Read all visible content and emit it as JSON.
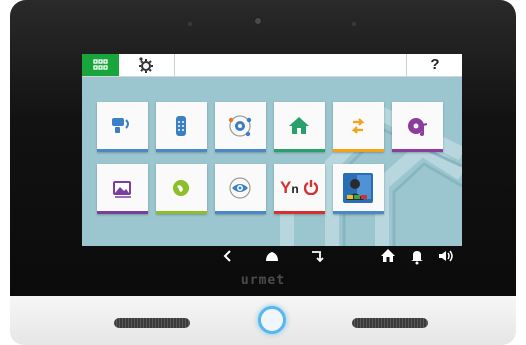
{
  "brand": {
    "logo_text": "urmet"
  },
  "topbar": {
    "home_icon": "grid-icon",
    "settings_icon": "gear-icon",
    "help_label": "?"
  },
  "tiles": [
    {
      "name": "intercom",
      "icon": "intercom-handset-icon",
      "bar_color": "#4a88c8"
    },
    {
      "name": "remote",
      "icon": "remote-control-icon",
      "bar_color": "#4a88c8"
    },
    {
      "name": "cctv-network",
      "icon": "cctv-network-icon",
      "bar_color": "#4a88c8"
    },
    {
      "name": "home-automation",
      "icon": "house-icon",
      "bar_color": "#27a06a"
    },
    {
      "name": "transfer",
      "icon": "swap-arrows-icon",
      "bar_color": "#f2a317"
    },
    {
      "name": "music",
      "icon": "music-disc-icon",
      "bar_color": "#8c3c9c"
    },
    {
      "name": "gallery",
      "icon": "photo-gallery-icon",
      "bar_color": "#7a3e9d"
    },
    {
      "name": "web",
      "icon": "globe-icon",
      "bar_color": "#8dbf2a"
    },
    {
      "name": "camera-view",
      "icon": "eye-camera-icon",
      "bar_color": "#4a88c8"
    },
    {
      "name": "yokis",
      "icon": "yokis-logo-icon",
      "label_y": "Y",
      "label_n": "n",
      "bar_color": "#d63131"
    },
    {
      "name": "contacts",
      "icon": "contact-card-icon",
      "bar_color": "#4a88c8"
    }
  ],
  "navbar": {
    "back_icon": "chevron-left-icon",
    "home_icon": "home-up-icon",
    "recent_icon": "corner-arrow-icon",
    "house_icon": "house-icon",
    "bell_icon": "bell-icon",
    "volume_icon": "volume-icon"
  },
  "hardware": {
    "main_button_color": "#59b6ef"
  }
}
